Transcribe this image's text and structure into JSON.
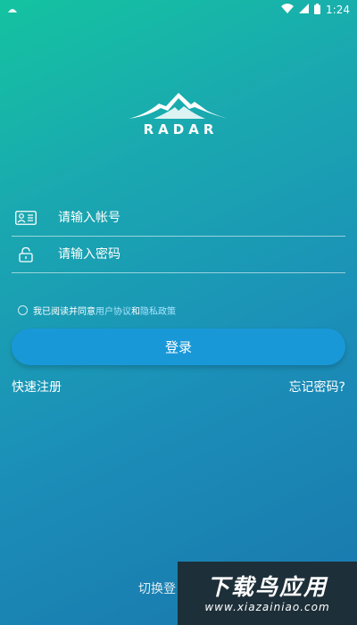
{
  "status_bar": {
    "time": "1:24",
    "icons": [
      "app-notification-icon",
      "wifi-icon",
      "signal-icon",
      "battery-icon"
    ]
  },
  "logo": {
    "text": "RADAR",
    "icon": "mountain-logo-icon"
  },
  "form": {
    "account_placeholder": "请输入帐号",
    "password_placeholder": "请输入密码",
    "account_icon": "id-card-icon",
    "password_icon": "lock-icon"
  },
  "agreement": {
    "prefix": "我已阅读并同意",
    "user_agreement": "用户协议",
    "and": "和",
    "privacy_policy": "隐私政策"
  },
  "buttons": {
    "login": "登录",
    "register": "快速注册",
    "forgot_password": "忘记密码?",
    "switch_login": "切换登"
  },
  "watermark": {
    "title": "下载鸟应用",
    "url": "www.xiazainiao.com"
  },
  "colors": {
    "gradient_top": "#14c3a0",
    "gradient_bottom": "#1a77ad",
    "login_button": "#1998d8",
    "link": "#a9e6ff"
  }
}
